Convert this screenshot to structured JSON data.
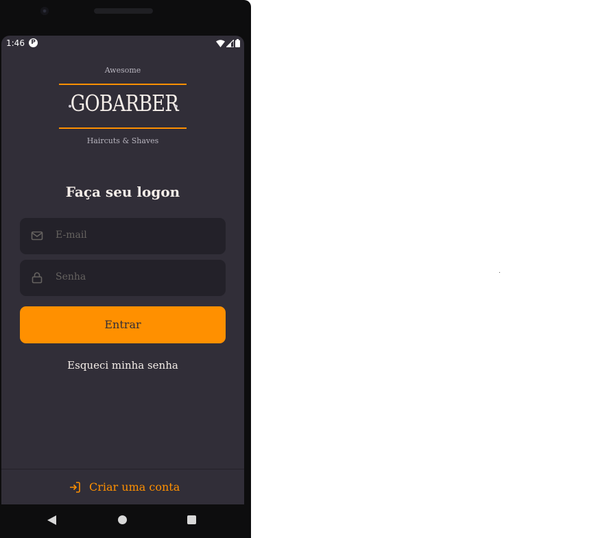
{
  "status_bar": {
    "time": "1:46",
    "app_icon": "P"
  },
  "logo": {
    "top_text": "Awesome",
    "title": "GOBARBER",
    "bottom_text": "Haircuts & Shaves"
  },
  "heading": "Faça seu logon",
  "form": {
    "email_placeholder": "E-mail",
    "password_placeholder": "Senha",
    "submit_label": "Entrar",
    "forgot_label": "Esqueci minha senha"
  },
  "footer": {
    "create_account_label": "Criar uma conta"
  },
  "colors": {
    "background": "#312e38",
    "input_background": "#232129",
    "accent": "#ff9000",
    "text": "#f4ede8",
    "placeholder": "#666360"
  },
  "icons": {
    "email": "mail-icon",
    "password": "lock-icon",
    "create_account": "log-in-icon"
  }
}
